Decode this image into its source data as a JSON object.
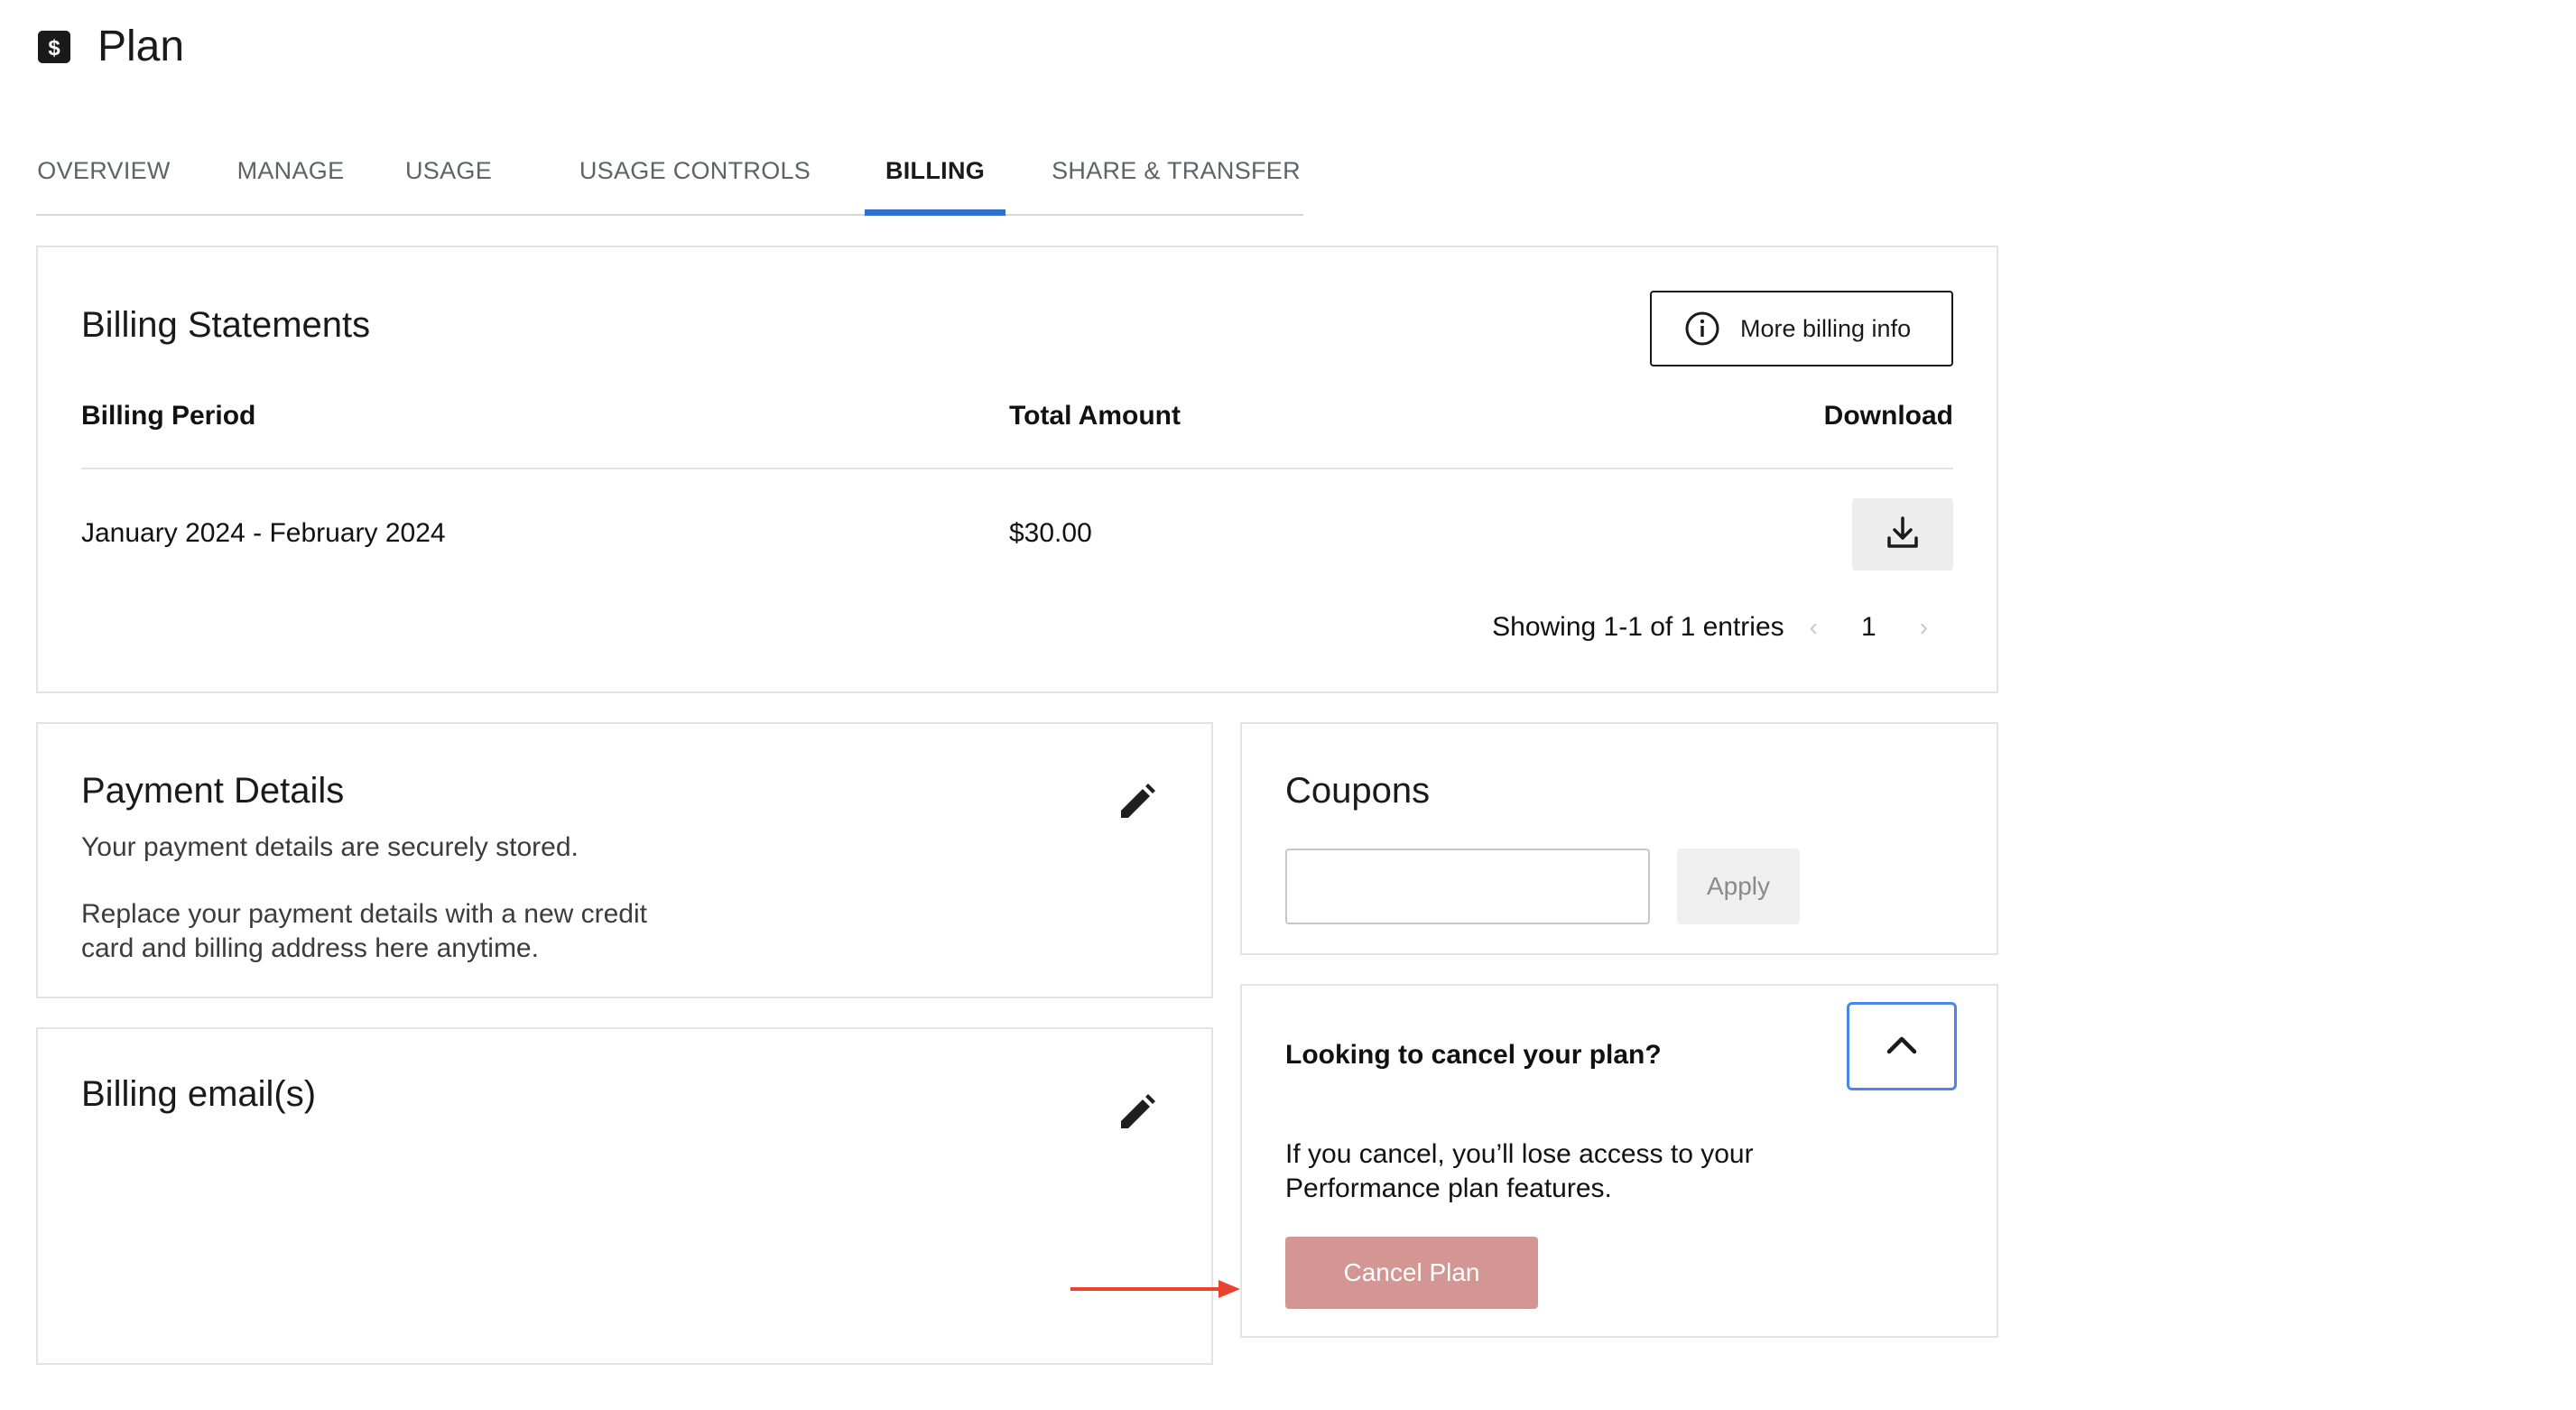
{
  "header": {
    "title": "Plan",
    "icon": "dollar-icon"
  },
  "tabs": [
    {
      "label": "OVERVIEW",
      "active": false
    },
    {
      "label": "MANAGE",
      "active": false
    },
    {
      "label": "USAGE",
      "active": false
    },
    {
      "label": "USAGE CONTROLS",
      "active": false
    },
    {
      "label": "BILLING",
      "active": true
    },
    {
      "label": "SHARE & TRANSFER",
      "active": false
    }
  ],
  "billing_statements": {
    "title": "Billing Statements",
    "more_info_label": "More billing info",
    "columns": {
      "period": "Billing Period",
      "amount": "Total Amount",
      "download": "Download"
    },
    "rows": [
      {
        "period": "January 2024 - February 2024",
        "amount": "$30.00"
      }
    ],
    "pagination": {
      "summary": "Showing 1-1 of 1 entries",
      "prev": "‹",
      "page": "1",
      "next": "›"
    }
  },
  "payment_details": {
    "title": "Payment Details",
    "line1": "Your payment details are securely stored.",
    "line2a": "Replace your payment details with a new credit",
    "line2b": "card and billing address here anytime."
  },
  "billing_emails": {
    "title": "Billing email(s)"
  },
  "coupons": {
    "title": "Coupons",
    "input_value": "",
    "apply_label": "Apply"
  },
  "cancel": {
    "question": "Looking to cancel your plan?",
    "warning_a": "If you cancel, you’ll lose access to your",
    "warning_b": "Performance plan features.",
    "button_label": "Cancel Plan"
  },
  "colors": {
    "accent_tab": "#2f6fd0",
    "cancel_button": "#d39692",
    "annotation_arrow": "#e8432e",
    "focus_border": "#4a86e8"
  }
}
